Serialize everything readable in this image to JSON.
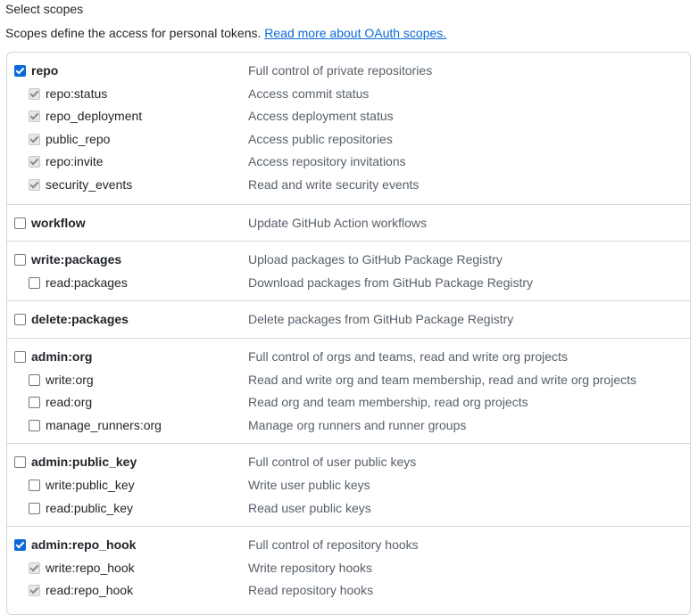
{
  "heading": "Select scopes",
  "intro": {
    "text": "Scopes define the access for personal tokens. ",
    "link": "Read more about OAuth scopes."
  },
  "groups": [
    {
      "scope": {
        "name": "repo",
        "description": "Full control of private repositories",
        "checked": true
      },
      "children": [
        {
          "name": "repo:status",
          "description": "Access commit status",
          "checked": true,
          "disabled": true
        },
        {
          "name": "repo_deployment",
          "description": "Access deployment status",
          "checked": true,
          "disabled": true
        },
        {
          "name": "public_repo",
          "description": "Access public repositories",
          "checked": true,
          "disabled": true
        },
        {
          "name": "repo:invite",
          "description": "Access repository invitations",
          "checked": true,
          "disabled": true
        },
        {
          "name": "security_events",
          "description": "Read and write security events",
          "checked": true,
          "disabled": true
        }
      ]
    },
    {
      "scope": {
        "name": "workflow",
        "description": "Update GitHub Action workflows",
        "checked": false
      },
      "children": []
    },
    {
      "scope": {
        "name": "write:packages",
        "description": "Upload packages to GitHub Package Registry",
        "checked": false
      },
      "children": [
        {
          "name": "read:packages",
          "description": "Download packages from GitHub Package Registry",
          "checked": false,
          "disabled": false
        }
      ]
    },
    {
      "scope": {
        "name": "delete:packages",
        "description": "Delete packages from GitHub Package Registry",
        "checked": false
      },
      "children": []
    },
    {
      "scope": {
        "name": "admin:org",
        "description": "Full control of orgs and teams, read and write org projects",
        "checked": false
      },
      "children": [
        {
          "name": "write:org",
          "description": "Read and write org and team membership, read and write org projects",
          "checked": false,
          "disabled": false
        },
        {
          "name": "read:org",
          "description": "Read org and team membership, read org projects",
          "checked": false,
          "disabled": false
        },
        {
          "name": "manage_runners:org",
          "description": "Manage org runners and runner groups",
          "checked": false,
          "disabled": false
        }
      ]
    },
    {
      "scope": {
        "name": "admin:public_key",
        "description": "Full control of user public keys",
        "checked": false
      },
      "children": [
        {
          "name": "write:public_key",
          "description": "Write user public keys",
          "checked": false,
          "disabled": false
        },
        {
          "name": "read:public_key",
          "description": "Read user public keys",
          "checked": false,
          "disabled": false
        }
      ]
    },
    {
      "scope": {
        "name": "admin:repo_hook",
        "description": "Full control of repository hooks",
        "checked": true
      },
      "children": [
        {
          "name": "write:repo_hook",
          "description": "Write repository hooks",
          "checked": true,
          "disabled": true
        },
        {
          "name": "read:repo_hook",
          "description": "Read repository hooks",
          "checked": true,
          "disabled": true
        }
      ]
    }
  ],
  "colors": {
    "accent": "#0969da",
    "border": "#d0d7de",
    "muted": "#57606a"
  }
}
